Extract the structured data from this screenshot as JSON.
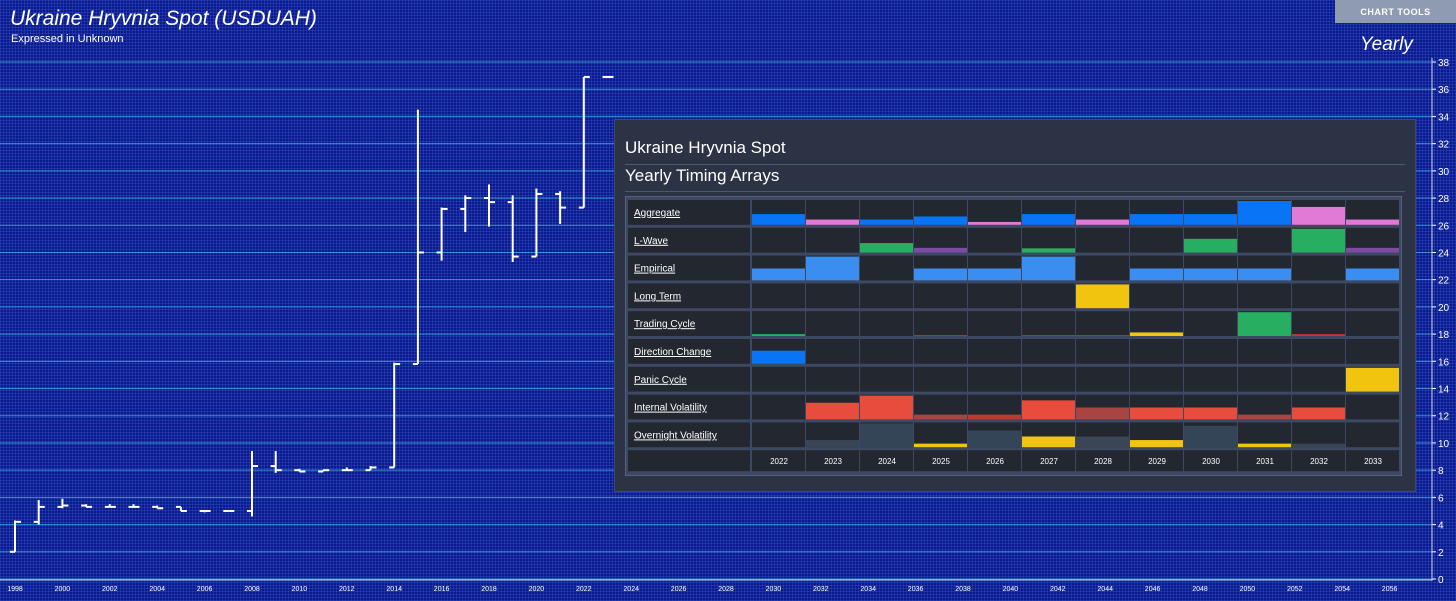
{
  "header": {
    "title": "Ukraine Hryvnia Spot (USDUAH)",
    "subtitle": "Expressed in Unknown",
    "period": "Yearly",
    "chart_tools_label": "CHART TOOLS"
  },
  "chart_data": [
    {
      "type": "ohlc",
      "x_tick_labels": [
        "1998",
        "2000",
        "2002",
        "2004",
        "2006",
        "2008",
        "2010",
        "2012",
        "2014",
        "2016",
        "2018",
        "2020",
        "2022",
        "2024",
        "2026",
        "2028",
        "2030",
        "2032",
        "2034",
        "2036",
        "2038",
        "2040",
        "2042",
        "2044",
        "2046",
        "2048",
        "2050",
        "2052",
        "2054",
        "2056"
      ],
      "y_ticks": [
        0,
        2,
        4,
        6,
        8,
        10,
        12,
        14,
        16,
        18,
        20,
        22,
        24,
        26,
        28,
        30,
        32,
        34,
        36,
        38
      ],
      "ylim": [
        0,
        38
      ],
      "xlim": [
        1998,
        2057
      ],
      "grid": true,
      "bars": [
        {
          "year": 1998,
          "open": 2.0,
          "high": 4.3,
          "low": 2.0,
          "close": 4.2
        },
        {
          "year": 1999,
          "open": 4.2,
          "high": 5.8,
          "low": 4.0,
          "close": 5.3
        },
        {
          "year": 2000,
          "open": 5.3,
          "high": 5.9,
          "low": 5.2,
          "close": 5.4
        },
        {
          "year": 2001,
          "open": 5.4,
          "high": 5.5,
          "low": 5.3,
          "close": 5.3
        },
        {
          "year": 2002,
          "open": 5.3,
          "high": 5.5,
          "low": 5.3,
          "close": 5.3
        },
        {
          "year": 2003,
          "open": 5.3,
          "high": 5.5,
          "low": 5.3,
          "close": 5.3
        },
        {
          "year": 2004,
          "open": 5.3,
          "high": 5.4,
          "low": 5.2,
          "close": 5.2
        },
        {
          "year": 2005,
          "open": 5.3,
          "high": 5.3,
          "low": 5.0,
          "close": 5.0
        },
        {
          "year": 2006,
          "open": 5.0,
          "high": 5.0,
          "low": 4.9,
          "close": 5.0
        },
        {
          "year": 2007,
          "open": 5.0,
          "high": 5.0,
          "low": 5.0,
          "close": 5.0
        },
        {
          "year": 2008,
          "open": 5.0,
          "high": 9.4,
          "low": 4.6,
          "close": 8.3
        },
        {
          "year": 2009,
          "open": 8.3,
          "high": 9.4,
          "low": 7.8,
          "close": 8.0
        },
        {
          "year": 2010,
          "open": 8.0,
          "high": 8.1,
          "low": 7.9,
          "close": 7.9
        },
        {
          "year": 2011,
          "open": 7.9,
          "high": 8.0,
          "low": 7.9,
          "close": 8.0
        },
        {
          "year": 2012,
          "open": 8.0,
          "high": 8.2,
          "low": 8.0,
          "close": 8.0
        },
        {
          "year": 2013,
          "open": 8.0,
          "high": 8.3,
          "low": 8.0,
          "close": 8.2
        },
        {
          "year": 2014,
          "open": 8.2,
          "high": 15.9,
          "low": 8.2,
          "close": 15.8
        },
        {
          "year": 2015,
          "open": 15.8,
          "high": 34.5,
          "low": 15.8,
          "close": 24.0
        },
        {
          "year": 2016,
          "open": 24.0,
          "high": 27.3,
          "low": 23.4,
          "close": 27.2
        },
        {
          "year": 2017,
          "open": 27.2,
          "high": 28.2,
          "low": 25.5,
          "close": 28.0
        },
        {
          "year": 2018,
          "open": 28.0,
          "high": 29.0,
          "low": 25.9,
          "close": 27.7
        },
        {
          "year": 2019,
          "open": 27.7,
          "high": 28.2,
          "low": 23.3,
          "close": 23.7
        },
        {
          "year": 2020,
          "open": 23.7,
          "high": 28.7,
          "low": 23.7,
          "close": 28.3
        },
        {
          "year": 2021,
          "open": 28.3,
          "high": 28.5,
          "low": 26.1,
          "close": 27.3
        },
        {
          "year": 2022,
          "open": 27.3,
          "high": 36.9,
          "low": 27.3,
          "close": 36.9
        },
        {
          "year": 2023,
          "open": 36.9,
          "high": 36.9,
          "low": 36.9,
          "close": 36.9
        }
      ]
    },
    {
      "type": "heatmap",
      "title": "Ukraine Hryvnia Spot",
      "subtitle": "Yearly Timing Arrays",
      "columns": [
        "2022",
        "2023",
        "2024",
        "2025",
        "2026",
        "2027",
        "2028",
        "2029",
        "2030",
        "2031",
        "2032",
        "2033"
      ],
      "rows": [
        {
          "label": "Aggregate",
          "cells": [
            {
              "v": 0.45,
              "c": "#0a74f7"
            },
            {
              "v": 0.22,
              "c": "#e07ad6"
            },
            {
              "v": 0.22,
              "c": "#0a74f7"
            },
            {
              "v": 0.35,
              "c": "#0a74f7"
            },
            {
              "v": 0.12,
              "c": "#e07ad6"
            },
            {
              "v": 0.45,
              "c": "#0a74f7"
            },
            {
              "v": 0.22,
              "c": "#e07ad6"
            },
            {
              "v": 0.45,
              "c": "#0a74f7"
            },
            {
              "v": 0.45,
              "c": "#0a74f7"
            },
            {
              "v": 1.0,
              "c": "#0a74f7"
            },
            {
              "v": 0.75,
              "c": "#e07ad6"
            },
            {
              "v": 0.22,
              "c": "#e07ad6"
            }
          ]
        },
        {
          "label": "L-Wave",
          "cells": [
            {
              "v": 0,
              "c": ""
            },
            {
              "v": 0,
              "c": ""
            },
            {
              "v": 0.4,
              "c": "#27ae60"
            },
            {
              "v": 0.2,
              "c": "#7d4aa4"
            },
            {
              "v": 0,
              "c": ""
            },
            {
              "v": 0.18,
              "c": "#27ae60"
            },
            {
              "v": 0,
              "c": ""
            },
            {
              "v": 0,
              "c": ""
            },
            {
              "v": 0.58,
              "c": "#27ae60"
            },
            {
              "v": 0,
              "c": ""
            },
            {
              "v": 1.0,
              "c": "#27ae60"
            },
            {
              "v": 0.2,
              "c": "#7d4aa4"
            }
          ]
        },
        {
          "label": "Empirical",
          "cells": [
            {
              "v": 0.5,
              "c": "#3b8ef0"
            },
            {
              "v": 1.0,
              "c": "#3b8ef0"
            },
            {
              "v": 0,
              "c": ""
            },
            {
              "v": 0.5,
              "c": "#3b8ef0"
            },
            {
              "v": 0.5,
              "c": "#3b8ef0"
            },
            {
              "v": 1.0,
              "c": "#3b8ef0"
            },
            {
              "v": 0,
              "c": ""
            },
            {
              "v": 0.5,
              "c": "#3b8ef0"
            },
            {
              "v": 0.5,
              "c": "#3b8ef0"
            },
            {
              "v": 0.5,
              "c": "#3b8ef0"
            },
            {
              "v": 0,
              "c": ""
            },
            {
              "v": 0.5,
              "c": "#3b8ef0"
            }
          ]
        },
        {
          "label": "Long Term",
          "cells": [
            {
              "v": 0,
              "c": ""
            },
            {
              "v": 0,
              "c": ""
            },
            {
              "v": 0,
              "c": ""
            },
            {
              "v": 0,
              "c": ""
            },
            {
              "v": 0,
              "c": ""
            },
            {
              "v": 0,
              "c": ""
            },
            {
              "v": 1.0,
              "c": "#f1c40f"
            },
            {
              "v": 0,
              "c": ""
            },
            {
              "v": 0,
              "c": ""
            },
            {
              "v": 0,
              "c": ""
            },
            {
              "v": 0,
              "c": ""
            },
            {
              "v": 0,
              "c": ""
            }
          ]
        },
        {
          "label": "Trading Cycle",
          "cells": [
            {
              "v": 0.08,
              "c": "#27ae60"
            },
            {
              "v": 0,
              "c": ""
            },
            {
              "v": 0,
              "c": ""
            },
            {
              "v": 0.04,
              "c": "#9e3b3b"
            },
            {
              "v": 0,
              "c": ""
            },
            {
              "v": 0.04,
              "c": "#9e3b3b"
            },
            {
              "v": 0.04,
              "c": "#9e3b3b"
            },
            {
              "v": 0.15,
              "c": "#f1c40f"
            },
            {
              "v": 0,
              "c": ""
            },
            {
              "v": 1.0,
              "c": "#27ae60"
            },
            {
              "v": 0.08,
              "c": "#c0392b"
            },
            {
              "v": 0,
              "c": ""
            }
          ]
        },
        {
          "label": "Direction Change",
          "cells": [
            {
              "v": 0.55,
              "c": "#0a74f7"
            },
            {
              "v": 0,
              "c": ""
            },
            {
              "v": 0,
              "c": ""
            },
            {
              "v": 0,
              "c": ""
            },
            {
              "v": 0,
              "c": ""
            },
            {
              "v": 0,
              "c": ""
            },
            {
              "v": 0,
              "c": ""
            },
            {
              "v": 0,
              "c": ""
            },
            {
              "v": 0,
              "c": ""
            },
            {
              "v": 0,
              "c": ""
            },
            {
              "v": 0,
              "c": ""
            },
            {
              "v": 0,
              "c": ""
            }
          ]
        },
        {
          "label": "Panic Cycle",
          "cells": [
            {
              "v": 0,
              "c": ""
            },
            {
              "v": 0,
              "c": ""
            },
            {
              "v": 0,
              "c": ""
            },
            {
              "v": 0,
              "c": ""
            },
            {
              "v": 0,
              "c": ""
            },
            {
              "v": 0,
              "c": ""
            },
            {
              "v": 0,
              "c": ""
            },
            {
              "v": 0,
              "c": ""
            },
            {
              "v": 0,
              "c": ""
            },
            {
              "v": 0,
              "c": ""
            },
            {
              "v": 0,
              "c": ""
            },
            {
              "v": 1.0,
              "c": "#f1c40f"
            }
          ]
        },
        {
          "label": "Internal Volatility",
          "cells": [
            {
              "v": 0,
              "c": ""
            },
            {
              "v": 0.7,
              "c": "#e74c3c"
            },
            {
              "v": 1.0,
              "c": "#e74c3c"
            },
            {
              "v": 0.2,
              "c": "#a94442"
            },
            {
              "v": 0.2,
              "c": "#c0392b"
            },
            {
              "v": 0.8,
              "c": "#e74c3c"
            },
            {
              "v": 0.5,
              "c": "#a94442"
            },
            {
              "v": 0.5,
              "c": "#e74c3c"
            },
            {
              "v": 0.5,
              "c": "#e74c3c"
            },
            {
              "v": 0.2,
              "c": "#a94442"
            },
            {
              "v": 0.5,
              "c": "#e74c3c"
            },
            {
              "v": 0,
              "c": ""
            }
          ]
        },
        {
          "label": "Overnight Volatility",
          "cells": [
            {
              "v": 0,
              "c": ""
            },
            {
              "v": 0.3,
              "c": "#3a4656"
            },
            {
              "v": 1.0,
              "c": "#354558"
            },
            {
              "v": 0.15,
              "c": "#f1c40f"
            },
            {
              "v": 0.7,
              "c": "#354558"
            },
            {
              "v": 0.45,
              "c": "#f1c40f"
            },
            {
              "v": 0.45,
              "c": "#3a4656"
            },
            {
              "v": 0.3,
              "c": "#f1c40f"
            },
            {
              "v": 0.9,
              "c": "#354558"
            },
            {
              "v": 0.15,
              "c": "#f1c40f"
            },
            {
              "v": 0.15,
              "c": "#3a4656"
            },
            {
              "v": 0,
              "c": ""
            }
          ]
        }
      ]
    }
  ]
}
